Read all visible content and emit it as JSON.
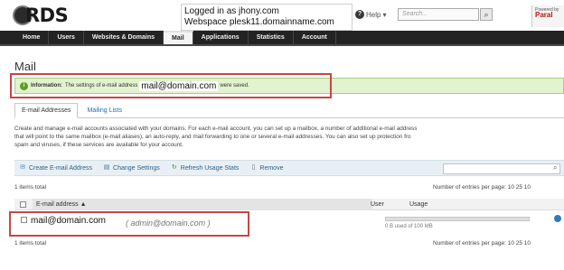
{
  "header": {
    "logo_text": "RDS",
    "login_line1": "Logged in as jhony.com",
    "login_line2": "Webspace plesk11.domainname.com",
    "help_label": "Help",
    "search_placeholder": "Search...",
    "brand_top": "Powered by",
    "brand_name": "Paral"
  },
  "nav": {
    "items": [
      "Home",
      "Users",
      "Websites & Domains",
      "Mail",
      "Applications",
      "Statistics",
      "Account"
    ],
    "active": "Mail"
  },
  "page": {
    "title": "Mail",
    "info_label": "Information:",
    "info_text_before": "The settings of e-mail address",
    "info_email": "mail@domain.com",
    "info_text_after": "were saved."
  },
  "tabs": [
    "E-mail Addresses",
    "Mailing Lists"
  ],
  "description": [
    "Create and manage e-mail accounts associated with your domains. For each e-mail account, you can set up a mailbox, a number of additional e-mail address",
    "that will point to the same mailbox (e-mail aliases), an auto-reply, and mail forwarding to one or several e-mail addresses. You can also set up protection fro",
    "spam and viruses, if these services are available for your account."
  ],
  "toolbar": {
    "create": "Create E-mail Address",
    "change": "Change Settings",
    "refresh": "Refresh Usage Stats",
    "remove": "Remove"
  },
  "table": {
    "items_total": "1 items total",
    "entries_per_page": "Number of entries per page: 10 25 10",
    "entries_per_page_bottom": "Number of entries per page: 10 25 10",
    "col_email": "E-mail address",
    "col_user": "User",
    "col_usage": "Usage",
    "rows": [
      {
        "email": "mail@domain.com",
        "alias": "( admin@domain.com )",
        "usage_text": "0 B used of 100 MB",
        "usage_fraction": 0
      }
    ]
  }
}
